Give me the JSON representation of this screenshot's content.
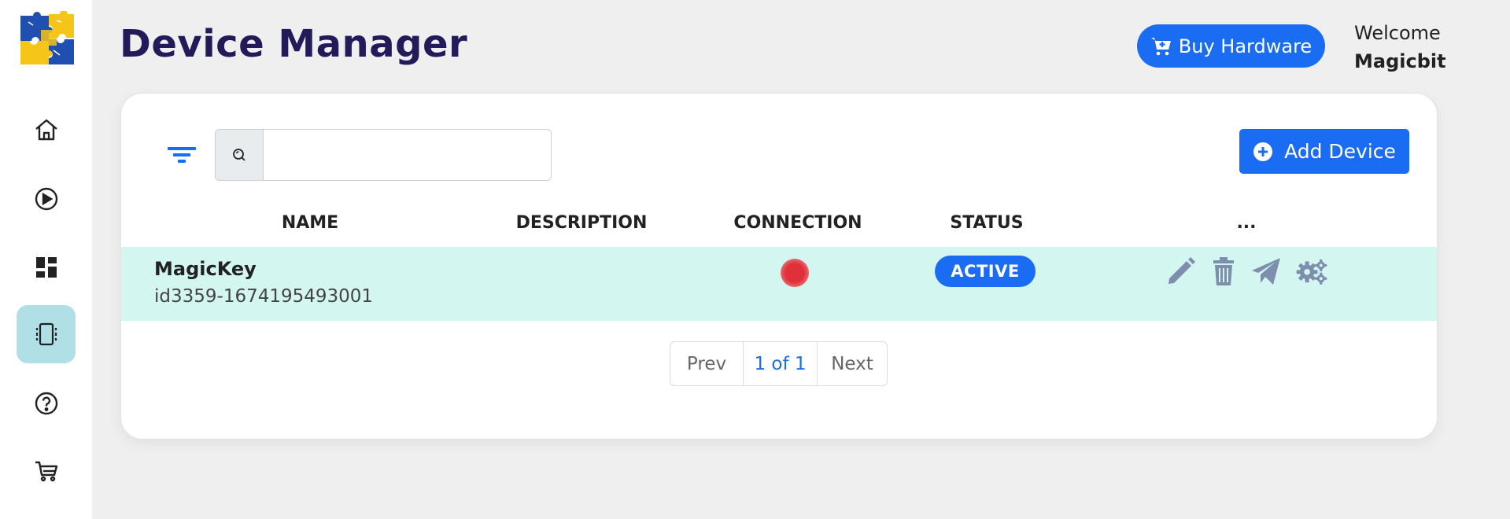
{
  "header": {
    "title": "Device Manager",
    "buy_label": "Buy Hardware",
    "welcome_label": "Welcome",
    "username": "Magicbit"
  },
  "sidebar": {
    "items": [
      {
        "name": "home",
        "icon": "home-icon"
      },
      {
        "name": "play",
        "icon": "play-circle-icon"
      },
      {
        "name": "dashboard",
        "icon": "dashboard-icon"
      },
      {
        "name": "devices",
        "icon": "device-icon",
        "active": true
      },
      {
        "name": "help",
        "icon": "help-circle-icon"
      },
      {
        "name": "cart",
        "icon": "cart-icon"
      }
    ]
  },
  "toolbar": {
    "search_placeholder": "",
    "search_value": "",
    "add_label": "Add Device"
  },
  "table": {
    "columns": [
      "NAME",
      "DESCRIPTION",
      "CONNECTION",
      "STATUS",
      "..."
    ],
    "rows": [
      {
        "name": "MagicKey",
        "id": "id3359-1674195493001",
        "description": "",
        "connection": "disconnected",
        "status": "ACTIVE"
      }
    ]
  },
  "pagination": {
    "prev_label": "Prev",
    "info": "1 of 1",
    "next_label": "Next"
  },
  "colors": {
    "accent": "#1a6cf2",
    "title": "#231a5a",
    "row_highlight": "#d4f6f1",
    "sidebar_active": "#b0e0e6",
    "action_icons": "#7e8fae",
    "connection_off": "#e0303a"
  }
}
